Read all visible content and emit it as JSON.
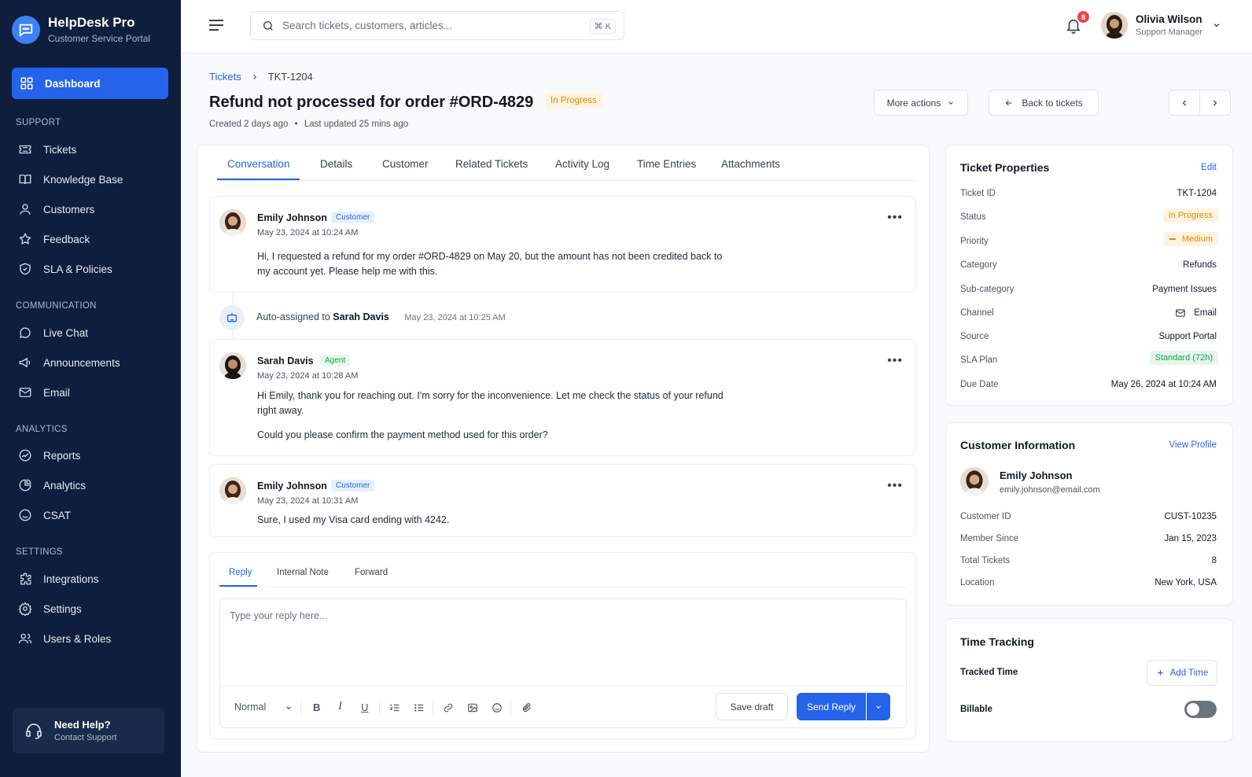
{
  "brand": {
    "name": "HelpDesk Pro",
    "subtitle": "Customer Service Portal"
  },
  "nav": {
    "dashboard": "Dashboard",
    "sections": {
      "support": "SUPPORT",
      "communication": "COMMUNICATION",
      "analytics": "ANALYTICS",
      "settings": "SETTINGS"
    },
    "support": [
      "Tickets",
      "Knowledge Base",
      "Customers",
      "Feedback",
      "SLA & Policies"
    ],
    "communication": [
      "Live Chat",
      "Announcements",
      "Email"
    ],
    "analytics": [
      "Reports",
      "Analytics",
      "CSAT"
    ],
    "settings": [
      "Integrations",
      "Settings",
      "Users & Roles"
    ]
  },
  "help": {
    "title": "Need Help?",
    "subtitle": "Contact Support"
  },
  "search": {
    "placeholder": "Search tickets, customers, articles...",
    "shortcut": "⌘ K"
  },
  "notifications": {
    "count": "8"
  },
  "user": {
    "name": "Olivia Wilson",
    "role": "Support Manager"
  },
  "breadcrumb": {
    "root": "Tickets",
    "current": "TKT-1204"
  },
  "ticket": {
    "title": "Refund not processed for order #ORD-4829",
    "status": "In Progress",
    "created": "Created 2 days ago",
    "sep": "•",
    "updated": "Last updated 25 mins ago"
  },
  "actions": {
    "more": "More actions",
    "back": "Back to tickets"
  },
  "tabs": [
    "Conversation",
    "Details",
    "Customer",
    "Related Tickets",
    "Activity Log",
    "Time Entries",
    "Attachments"
  ],
  "messages": [
    {
      "name": "Emily Johnson",
      "badge": "Customer",
      "time": "May 23, 2024 at 10:24 AM",
      "body": "Hi, I requested a refund for my order #ORD-4829 on May 20, but the amount has not been credited back to my account yet. Please help me with this."
    },
    {
      "name": "Sarah Davis",
      "badge": "Agent",
      "time": "May 23, 2024 at 10:28 AM",
      "body": "Hi Emily, thank you for reaching out.  I'm sorry for the inconvenience. Let me check the status of your refund right away.",
      "body2": "Could you please confirm the payment method used for this order?"
    },
    {
      "name": "Emily Johnson",
      "badge": "Customer",
      "time": "May 23, 2024 at 10:31 AM",
      "body": "Sure, I used my Visa card ending with 4242."
    }
  ],
  "system_event": {
    "prefix": "Auto-assigned to",
    "who": "Sarah Davis",
    "time": "May 23, 2024 at 10:25 AM"
  },
  "reply": {
    "tabs": [
      "Reply",
      "Internal Note",
      "Forward"
    ],
    "placeholder": "Type your reply here...",
    "format": "Normal",
    "save_draft": "Save draft",
    "send": "Send Reply"
  },
  "properties": {
    "title": "Ticket Properties",
    "edit": "Edit",
    "rows": [
      {
        "label": "Ticket ID",
        "value": "TKT-1204"
      },
      {
        "label": "Status",
        "value": "In Progress"
      },
      {
        "label": "Priority",
        "value": "Medium"
      },
      {
        "label": "Category",
        "value": "Refunds"
      },
      {
        "label": "Sub-category",
        "value": "Payment Issues"
      },
      {
        "label": "Channel",
        "value": "Email"
      },
      {
        "label": "Source",
        "value": "Support Portal"
      },
      {
        "label": "SLA Plan",
        "value": "Standard (72h)"
      },
      {
        "label": "Due Date",
        "value": "May 26, 2024 at 10:24 AM"
      }
    ]
  },
  "customer_info": {
    "title": "Customer Information",
    "link": "View Profile",
    "name": "Emily Johnson",
    "email": "emily.johnson@email.com",
    "rows": [
      {
        "label": "Customer ID",
        "value": "CUST-10235"
      },
      {
        "label": "Member Since",
        "value": "Jan 15, 2023"
      },
      {
        "label": "Total Tickets",
        "value": "8"
      },
      {
        "label": "Location",
        "value": "New York, USA"
      }
    ]
  },
  "time_tracking": {
    "title": "Time Tracking",
    "tracked": "Tracked Time",
    "add": "Add Time",
    "billable": "Billable",
    "billable_on": false
  },
  "colors": {
    "accent": "#2563eb",
    "sidebar": "#0f1e3d",
    "warning": "#e08a00",
    "success": "#16a34a"
  }
}
